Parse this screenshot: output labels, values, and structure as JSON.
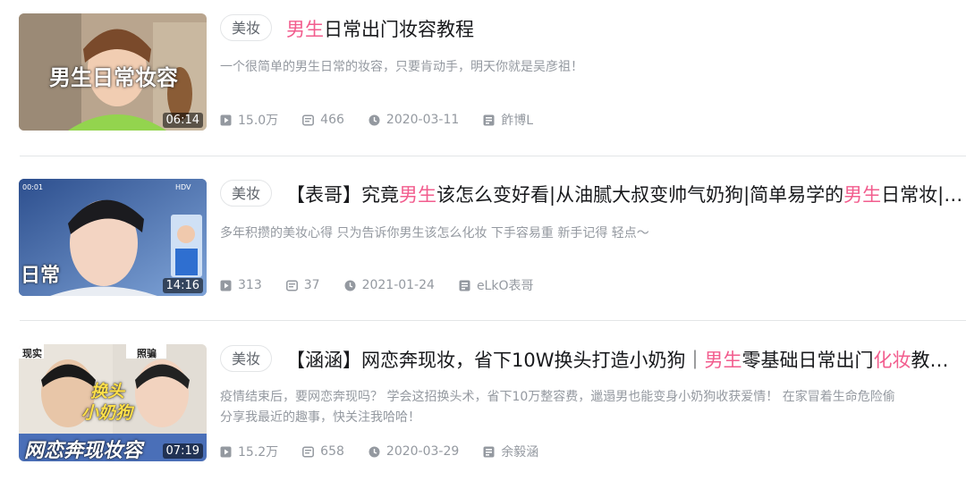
{
  "videos": [
    {
      "tag": "美妆",
      "title_parts": [
        {
          "text": "男生",
          "hl": true
        },
        {
          "text": "日常出门妆容教程",
          "hl": false
        }
      ],
      "description": "一个很简单的男生日常的妆容，只要肯动手，明天你就是吴彦祖！",
      "thumb_caption": "男生日常妆容",
      "duration": "06:14",
      "views": "15.0万",
      "danmaku": "466",
      "date": "2020-03-11",
      "author": "飵博L"
    },
    {
      "tag": "美妆",
      "title_parts": [
        {
          "text": "【表哥】究竟",
          "hl": false
        },
        {
          "text": "男生",
          "hl": true
        },
        {
          "text": "该怎么变好看|从油腻大叔变帅气奶狗|简单易学的",
          "hl": false
        },
        {
          "text": "男生",
          "hl": true
        },
        {
          "text": "日常妆|假.",
          "hl": false
        }
      ],
      "description": "多年积攒的美妆心得 只为告诉你男生该怎么化妆 下手容易重 新手记得 轻点～",
      "thumb_caption": "日常",
      "duration": "14:16",
      "views": "313",
      "danmaku": "37",
      "date": "2021-01-24",
      "author": "eLkO表哥"
    },
    {
      "tag": "美妆",
      "title_parts": [
        {
          "text": "【涵涵】网恋奔现妆，省下10W换头打造小奶狗｜",
          "hl": false
        },
        {
          "text": "男生",
          "hl": true
        },
        {
          "text": "零基础日常出门",
          "hl": false
        },
        {
          "text": "化妆",
          "hl": true
        },
        {
          "text": "教程…",
          "hl": false
        }
      ],
      "description_line1": "疫情结束后，要网恋奔现吗？ 学会这招换头术，省下10万整容费，邋遢男也能变身小奶狗收获爱情！ 在家冒着生命危险偷",
      "description_line2": "分享我最近的趣事，快关注我哈哈！",
      "thumb_caption": "网恋奔现妆容",
      "thumb_labels": [
        "现实",
        "照骗",
        "换头",
        "小奶狗"
      ],
      "duration": "07:19",
      "views": "15.2万",
      "danmaku": "658",
      "date": "2020-03-29",
      "author": "余毅涵"
    }
  ],
  "icons": {
    "views": "play-count-icon",
    "danmaku": "danmaku-icon",
    "date": "clock-icon",
    "author": "uploader-icon"
  },
  "colors": {
    "highlight": "#f25d8e",
    "meta": "#9499a0"
  }
}
